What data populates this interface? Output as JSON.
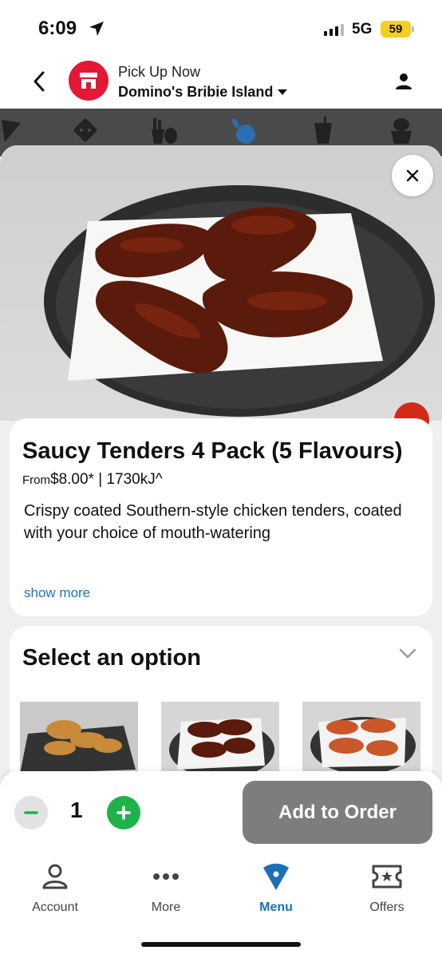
{
  "status_bar": {
    "time": "6:09",
    "network": "5G",
    "battery": "59"
  },
  "header": {
    "pickup_label": "Pick Up Now",
    "store_name": "Domino's Bribie Island"
  },
  "categories": [
    "pizza-icon",
    "sides-icon",
    "fries-icon",
    "chicken-icon",
    "drinks-icon",
    "desserts-icon"
  ],
  "product": {
    "title": "Saucy Tenders 4 Pack (5 Flavours)",
    "price_prefix": "From",
    "price": "$8.00* | 1730kJ^",
    "description": "Crispy coated Southern-style chicken tenders, coated with your choice of mouth-watering",
    "show_more": "show more"
  },
  "options": {
    "title": "Select an option"
  },
  "order": {
    "quantity": "1",
    "add_label": "Add to Order"
  },
  "tabs": [
    {
      "label": "Account",
      "icon": "account-icon"
    },
    {
      "label": "More",
      "icon": "more-icon"
    },
    {
      "label": "Menu",
      "icon": "menu-icon",
      "active": true
    },
    {
      "label": "Offers",
      "icon": "offers-icon"
    }
  ],
  "colors": {
    "brand_red": "#e31837",
    "brand_blue": "#1a6fb8",
    "plus_green": "#1fb24a",
    "link_blue": "#1a73c8"
  }
}
